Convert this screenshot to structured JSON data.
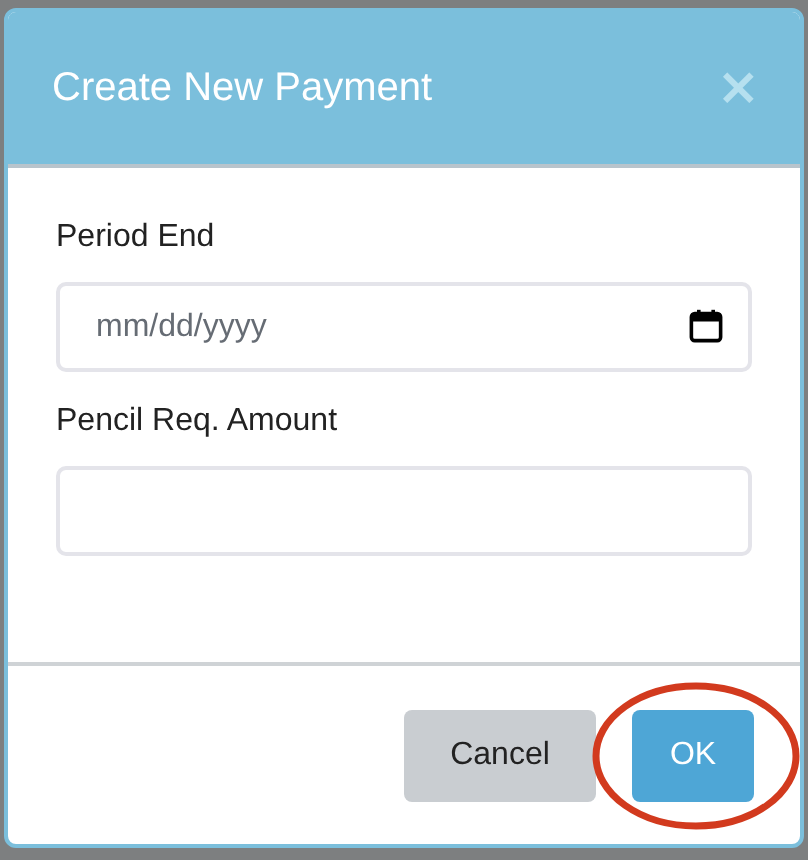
{
  "dialog": {
    "title": "Create New Payment",
    "close": "×",
    "fields": [
      {
        "kind": "date",
        "label": "Period End",
        "placeholder": "mm/dd/yyyy"
      },
      {
        "kind": "text",
        "label": "Pencil Req. Amount"
      }
    ],
    "buttons": [
      {
        "label": "Cancel",
        "kind": "secondary",
        "highlighted": false
      },
      {
        "label": "OK",
        "kind": "primary",
        "highlighted": true
      }
    ]
  }
}
